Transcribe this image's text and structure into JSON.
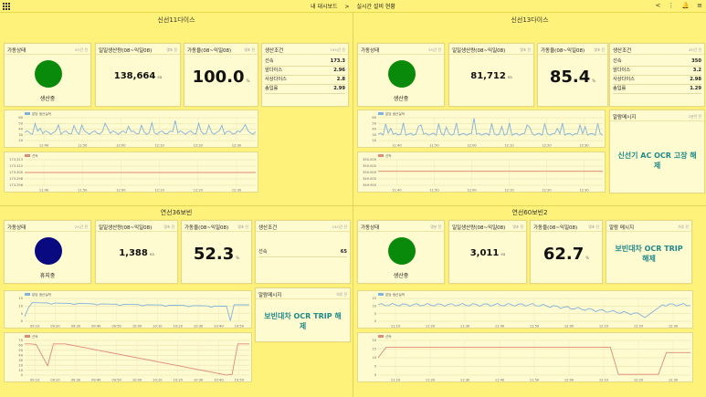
{
  "header": {
    "crumb1": "내 대시보드",
    "sep": ">",
    "crumb2": "실시간 설비 현황",
    "icons": [
      "share-icon",
      "more-vert-icon",
      "bell-icon",
      "list-icon"
    ]
  },
  "panels": [
    {
      "title": "신선11다이스",
      "status": {
        "label": "가동상태",
        "time": "5시간 전",
        "state": "생산중",
        "color": "#0a8a0a"
      },
      "production": {
        "label": "일일생산량(08~익일08)",
        "time": "몇초 전",
        "value": "138,664",
        "unit": "ea"
      },
      "rate": {
        "label": "가동율(08~익일08)",
        "time": "몇초 전",
        "value": "100.0",
        "unit": "%"
      },
      "conditions": {
        "label": "생산조건",
        "time": "19시간 전",
        "rows": [
          {
            "k": "선속",
            "v": "173.3"
          },
          {
            "k": "앞다이스",
            "v": "2.96"
          },
          {
            "k": "사상다이스",
            "v": "2.8"
          },
          {
            "k": "송입률",
            "v": "2.99"
          }
        ]
      },
      "alarm": null,
      "chart1": {
        "legend": "분당 생산실적",
        "yticks": [
          "60",
          "50",
          "40",
          "30",
          "20"
        ],
        "xticks": [
          "11:40",
          "11:50",
          "12:00",
          "12:10",
          "12:20",
          "12:30"
        ]
      },
      "chart2": {
        "legend": "선속",
        "yticks": [
          "173.313",
          "173.312",
          "173.300",
          "173.298",
          "173.296"
        ],
        "xticks": [
          "11:40",
          "11:50",
          "12:00",
          "12:10",
          "12:20",
          "12:30"
        ]
      }
    },
    {
      "title": "신선13다이스",
      "status": {
        "label": "가동상태",
        "time": "3시간 전",
        "state": "생산중",
        "color": "#0a8a0a"
      },
      "production": {
        "label": "일일생산량(08~익일08)",
        "time": "몇초 전",
        "value": "81,712",
        "unit": "ea"
      },
      "rate": {
        "label": "가동율(08~익일08)",
        "time": "몇초 전",
        "value": "85.4",
        "unit": "%"
      },
      "conditions": {
        "label": "생산조건",
        "time": "4시간 전",
        "rows": [
          {
            "k": "선속",
            "v": "350"
          },
          {
            "k": "앞다이스",
            "v": "3.2"
          },
          {
            "k": "사상다이스",
            "v": "2.98"
          },
          {
            "k": "송입률",
            "v": "1.29"
          }
        ]
      },
      "alarm": {
        "label": "알람메시지",
        "time": "2분전 전",
        "text": "신선기 AC OCR 고장 해제"
      },
      "chart1": {
        "legend": "분당 생산실적",
        "yticks": [
          "60",
          "50",
          "40",
          "30",
          "20"
        ],
        "xticks": [
          "11:40",
          "11:50",
          "12:00",
          "12:10",
          "12:20",
          "12:30"
        ]
      },
      "chart2": {
        "legend": "선속",
        "yticks": [
          "350.000",
          "350.000",
          "350.000",
          "349.000",
          "349.950"
        ],
        "xticks": [
          "11:40",
          "11:50",
          "12:00",
          "12:10",
          "12:20",
          "12:30"
        ]
      }
    },
    {
      "title": "연선36보빈",
      "status": {
        "label": "가동상태",
        "time": "2시간 전",
        "state": "휴지중",
        "color": "#0a0a80"
      },
      "production": {
        "label": "일일생산량(08~익일08)",
        "time": "몇초 전",
        "value": "1,388",
        "unit": "ea"
      },
      "rate": {
        "label": "가동율(08~익일08)",
        "time": "몇초 전",
        "value": "52.3",
        "unit": "%"
      },
      "conditions": {
        "label": "생산조건",
        "time": "19시간 전",
        "rows": [
          {
            "k": "선속",
            "v": "65"
          }
        ]
      },
      "alarm": {
        "label": "알람메시지",
        "time": "하루 전",
        "text": "보빈대차 OCR TRIP 해제"
      },
      "chart1": {
        "legend": "분당 생산실적",
        "yticks": [
          "15",
          "10",
          "5",
          "0"
        ],
        "xticks": [
          "09:10",
          "09:20",
          "09:30",
          "09:40",
          "09:50",
          "10:00",
          "10:10",
          "10:20",
          "10:30",
          "10:40",
          "10:50"
        ]
      },
      "chart2": {
        "legend": "선속",
        "yticks": [
          "70",
          "60",
          "50",
          "40",
          "30",
          "20",
          "10",
          "0"
        ],
        "xticks": [
          "09:10",
          "09:20",
          "09:30",
          "09:40",
          "09:50",
          "10:00",
          "10:10",
          "10:20",
          "10:30",
          "10:40",
          "10:50"
        ]
      }
    },
    {
      "title": "연선60보빈2",
      "status": {
        "label": "가동상태",
        "time": "몇분 전",
        "state": "생산중",
        "color": "#0a8a0a"
      },
      "production": {
        "label": "일일생산량(08~익일08)",
        "time": "몇초 전",
        "value": "3,011",
        "unit": "ea"
      },
      "rate": {
        "label": "가동율(08~익일08)",
        "time": "몇초 전",
        "value": "62.7",
        "unit": "%"
      },
      "conditions": null,
      "alarm": {
        "label": "알람 메시지",
        "time": "하루 전",
        "text": "보빈대차 OCR TRIP 해제"
      },
      "chart1": {
        "legend": "분당 생산실적",
        "yticks": [
          "15",
          "10",
          "5",
          "0"
        ],
        "xticks": [
          "11:10",
          "11:20",
          "11:30",
          "11:40",
          "11:50",
          "12:00",
          "12:10",
          "12:20",
          "12:30"
        ]
      },
      "chart2": {
        "legend": "선속",
        "yticks": [
          "20",
          "15",
          "10",
          "5",
          "0"
        ],
        "xticks": [
          "11:10",
          "11:20",
          "11:30",
          "11:40",
          "11:50",
          "12:00",
          "12:10",
          "12:20",
          "12:30"
        ]
      }
    }
  ],
  "colors": {
    "line_blue": "#7fb2dc",
    "line_red": "#e08a78",
    "alarm_text": "#1e8a8a"
  }
}
